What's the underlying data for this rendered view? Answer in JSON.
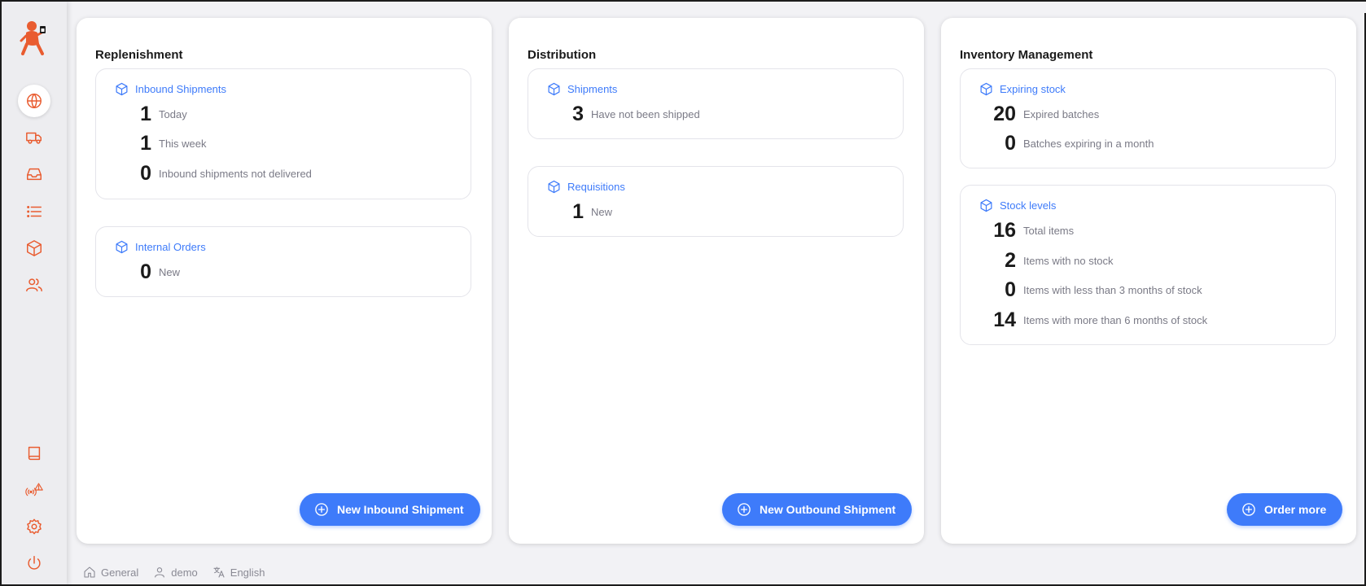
{
  "colors": {
    "brand": "#e95c30",
    "accent": "#3e7bfa",
    "text_muted": "#7a7a86"
  },
  "sidebar": {
    "logo": "store-mascot-logo",
    "top_items": [
      {
        "icon": "globe-icon",
        "active": true
      },
      {
        "icon": "truck-icon",
        "active": false
      },
      {
        "icon": "inbox-icon",
        "active": false
      },
      {
        "icon": "list-icon",
        "active": false
      },
      {
        "icon": "box-icon",
        "active": false
      },
      {
        "icon": "users-icon",
        "active": false
      }
    ],
    "bottom_items": [
      {
        "icon": "book-icon"
      },
      {
        "icon": "sync-warning-icon"
      },
      {
        "icon": "gear-icon"
      },
      {
        "icon": "power-icon"
      }
    ]
  },
  "panels": {
    "replenishment": {
      "title": "Replenishment",
      "inbound": {
        "title": "Inbound Shipments",
        "stats": [
          {
            "value": "1",
            "label": "Today"
          },
          {
            "value": "1",
            "label": "This week"
          },
          {
            "value": "0",
            "label": "Inbound shipments not delivered"
          }
        ]
      },
      "internal_orders": {
        "title": "Internal Orders",
        "stats": [
          {
            "value": "0",
            "label": "New"
          }
        ]
      },
      "button": "New Inbound Shipment"
    },
    "distribution": {
      "title": "Distribution",
      "shipments": {
        "title": "Shipments",
        "stats": [
          {
            "value": "3",
            "label": "Have not been shipped"
          }
        ]
      },
      "requisitions": {
        "title": "Requisitions",
        "stats": [
          {
            "value": "1",
            "label": "New"
          }
        ]
      },
      "button": "New Outbound Shipment"
    },
    "inventory": {
      "title": "Inventory Management",
      "expiring": {
        "title": "Expiring stock",
        "stats": [
          {
            "value": "20",
            "label": "Expired batches"
          },
          {
            "value": "0",
            "label": "Batches expiring in a month"
          }
        ]
      },
      "stock_levels": {
        "title": "Stock levels",
        "stats": [
          {
            "value": "16",
            "label": "Total items"
          },
          {
            "value": "2",
            "label": "Items with no stock"
          },
          {
            "value": "0",
            "label": "Items with less than 3 months of stock"
          },
          {
            "value": "14",
            "label": "Items with more than 6 months of stock"
          }
        ]
      },
      "button": "Order more"
    }
  },
  "footer": {
    "store": "General",
    "user": "demo",
    "language": "English"
  }
}
